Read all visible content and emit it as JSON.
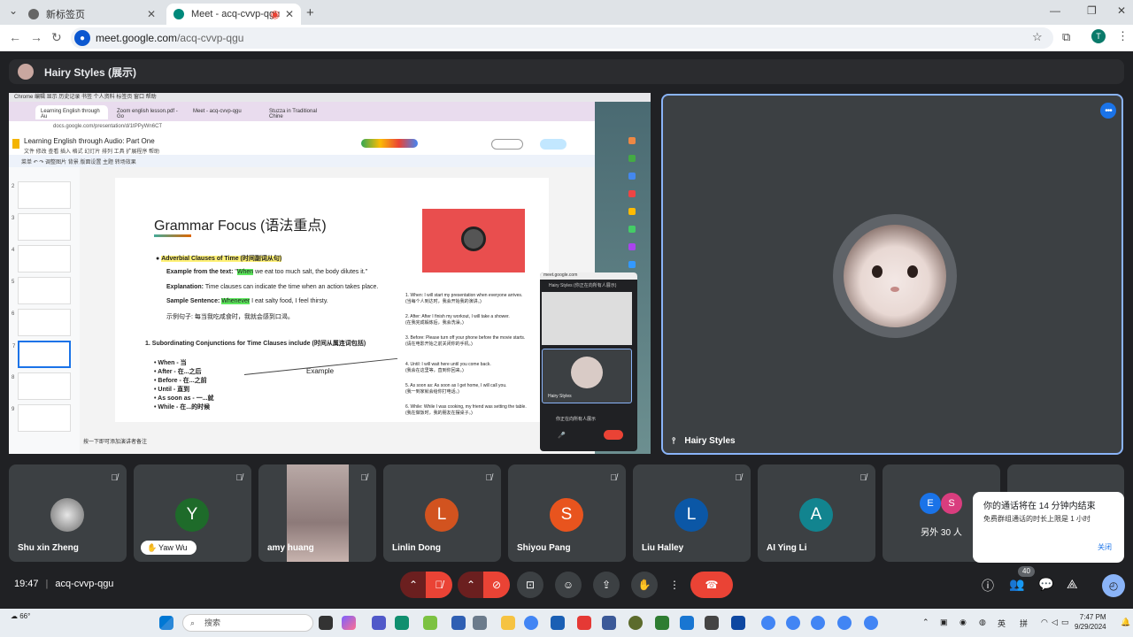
{
  "browser": {
    "tabs": [
      {
        "title": "新标签页",
        "active": false
      },
      {
        "title": "Meet - acq-cvvp-qgu",
        "active": true
      }
    ],
    "url_host": "meet.google.com",
    "url_path": "/acq-cvvp-qgu",
    "profile_initial": "T"
  },
  "meet": {
    "presenter_label": "Hairy Styles (展示)",
    "main_tile_name": "Hairy Styles",
    "participants": [
      {
        "name": "Shu xin Zheng",
        "avatar": "",
        "color": "#8d8d8d",
        "type": "photo"
      },
      {
        "name": "Yaw Wu",
        "avatar": "Y",
        "color": "#1e6b2a",
        "type": "hand"
      },
      {
        "name": "amy huang",
        "avatar": "",
        "color": "#6f5d5a",
        "type": "video"
      },
      {
        "name": "Linlin Dong",
        "avatar": "L",
        "color": "#d2531f",
        "type": "letter"
      },
      {
        "name": "Shiyou Pang",
        "avatar": "S",
        "color": "#e8541e",
        "type": "letter"
      },
      {
        "name": "Liu Halley",
        "avatar": "L",
        "color": "#0b57a6",
        "type": "letter"
      },
      {
        "name": "AI Ying Li",
        "avatar": "A",
        "color": "#12848f",
        "type": "letter"
      }
    ],
    "others": {
      "a": "E",
      "b": "S",
      "label": "另外 30 人"
    },
    "toast": {
      "line1": "你的通话将在 14 分钟内结束",
      "line2": "免费群组通话的时长上限是 1 小时",
      "close": "关闭"
    },
    "time": "19:47",
    "meeting_code": "acq-cvvp-qgu",
    "people_count": "40"
  },
  "shared_screen": {
    "mac_menu": "Chrome  编辑  显示  历史记录  书签  个人资料  标签页  窗口  帮助",
    "tabs": [
      "Learning English through Au",
      "Zoom english lesson.pdf - Go",
      "Meet - acq-cvvp-qgu",
      "Stuzza in Traditional Chine"
    ],
    "url": "docs.google.com/presentation/d/1tPPyWn6CT",
    "doc_title": "Learning English through Audio: Part One",
    "doc_menu": "文件  修改  查看  插入  格式  幻灯片  排列  工具  扩展程序  帮助",
    "toolbar": "菜单  ↶ ↷  调整图片  背景  版面设置  主题  转场效果",
    "slide": {
      "heading": "Grammar Focus (语法重点)",
      "bullet": "Adverbial Clauses of Time (时间副词从句)",
      "example_prefix": "Example from the text:",
      "example_hl": "When",
      "example_rest": "we eat too much salt, the body dilutes it.",
      "explanation": "Time clauses can indicate the time when an action takes place.",
      "sample_prefix": "Sample Sentence:",
      "sample_hl": "Whenever",
      "sample_rest": "I eat salty food, I feel thirsty.",
      "cn_example": "示例句子: 每当我吃咸食时，我就会感到口渴。",
      "section": "1. Subordinating Conjunctions for Time Clauses include (时间从属连词包括)",
      "conjunctions": [
        "When - 当",
        "After - 在...之后",
        "Before - 在...之前",
        "Until - 直到",
        "As soon as - 一...就",
        "While - 在...的时候"
      ],
      "example_label": "Example",
      "right_items": [
        {
          "en": "1. When: I will start my presentation when everyone arrives.",
          "cn": "(当每个人到达时，我会开始我的演讲。)"
        },
        {
          "en": "2. After: After I finish my workout, I will take a shower.",
          "cn": "(在我完成锻炼后，我会洗澡。)"
        },
        {
          "en": "3. Before: Please turn off your phone before the movie starts.",
          "cn": "(请在电影开始之前关闭你的手机。)"
        },
        {
          "en": "4. Until: I will wait here until you come back.",
          "cn": "(我会在这里等，直到你回来。)"
        },
        {
          "en": "5. As soon as: As soon as I get home, I will call you.",
          "cn": "(我一到家就会给你打电话。)"
        },
        {
          "en": "6. While: While I was cooking, my friend was setting the table.",
          "cn": "(我在做饭时，我的朋友在摆桌子。)"
        }
      ]
    },
    "speaker_tip": "按一下即可添加演讲者备注",
    "mini_meet": {
      "url": "meet.google.com",
      "header": "Hairy Styles (你正在向所有人展示)",
      "tile_name": "Hairy Styles",
      "note": "你正在向所有人展示"
    }
  },
  "taskbar": {
    "weather": "66°",
    "search_placeholder": "搜索",
    "ime": "英",
    "ime2": "拼",
    "time": "7:47 PM",
    "date": "9/29/2024"
  }
}
